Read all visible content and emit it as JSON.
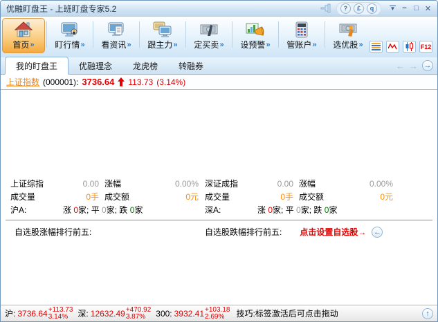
{
  "window": {
    "title": "优融盯盘王 - 上班盯盘专家5.2",
    "round_buttons": {
      "help": "?",
      "currency": "£",
      "quote": "q"
    },
    "controls": {
      "tray": "▼",
      "minimize": "−",
      "maximize": "□",
      "close": "✕"
    }
  },
  "toolbar": {
    "chevron": "»",
    "f12_label": "F12",
    "buttons": [
      {
        "label": "首页",
        "icon": "home-icon",
        "active": true
      },
      {
        "label": "盯行情",
        "icon": "watch-market-icon",
        "active": false
      },
      {
        "label": "看资讯",
        "icon": "news-icon",
        "active": false
      },
      {
        "label": "跟主力",
        "icon": "follow-mainforce-icon",
        "active": false
      },
      {
        "label": "定买卖",
        "icon": "set-trade-icon",
        "active": false
      },
      {
        "label": "设预警",
        "icon": "set-alert-icon",
        "active": false
      },
      {
        "label": "管账户",
        "icon": "manage-account-icon",
        "active": false
      },
      {
        "label": "选优股",
        "icon": "pick-stock-icon",
        "active": false
      }
    ]
  },
  "tabbar": {
    "tabs": [
      {
        "label": "我的盯盘王",
        "active": true
      },
      {
        "label": "优融理念",
        "active": false
      },
      {
        "label": "龙虎榜",
        "active": false
      },
      {
        "label": "转融券",
        "active": false
      }
    ],
    "nav_back": "←",
    "nav_forward": "→",
    "nav_go": "→"
  },
  "index_header": {
    "name": "上证指数",
    "code": "(000001):",
    "price": "3736.64",
    "change": "113.73",
    "change_pct": "(3.14%)"
  },
  "market_stats": {
    "left": {
      "index_label": "上证综指",
      "index_value": "0.00",
      "chg_label": "涨幅",
      "chg_value": "0.00%",
      "vol_label": "成交量",
      "vol_value": "0手",
      "amt_label": "成交额",
      "amt_value": "0元",
      "board_label": "沪A:",
      "up": {
        "label": "涨 ",
        "value": "0",
        "unit": "家; "
      },
      "flat": {
        "label": "平 ",
        "value": "0",
        "unit": "家; "
      },
      "down": {
        "label": "跌 ",
        "value": "0",
        "unit": "家"
      }
    },
    "right": {
      "index_label": "深证成指",
      "index_value": "0.00",
      "chg_label": "涨幅",
      "chg_value": "0.00%",
      "vol_label": "成交量",
      "vol_value": "0手",
      "amt_label": "成交额",
      "amt_value": "0元",
      "board_label": "深A:",
      "up": {
        "label": "涨 ",
        "value": "0",
        "unit": "家; "
      },
      "flat": {
        "label": "平 ",
        "value": "0",
        "unit": "家; "
      },
      "down": {
        "label": "跌 ",
        "value": "0",
        "unit": "家"
      }
    }
  },
  "watchlist": {
    "gainers_label": "自选股涨幅排行前五:",
    "losers_label": "自选股跌幅排行前五:",
    "setup_hint": "点击设置自选股→",
    "collapse_arrow": "←"
  },
  "statusbar": {
    "items": [
      {
        "label": "沪:",
        "value": "3736.64",
        "change": "+113.73",
        "pct": "3.14%"
      },
      {
        "label": "深:",
        "value": "12632.49",
        "change": "+470.92",
        "pct": "3.87%"
      },
      {
        "label": "300:",
        "value": "3932.41",
        "change": "+103.18",
        "pct": "2.69%"
      }
    ],
    "tip": "技巧:标签激活后可点击拖动",
    "top_arrow": "↑"
  },
  "colors": {
    "up_red": "#e00000",
    "down_green": "#007700",
    "value_orange": "#ff8c00",
    "neutral_gray": "#9a9a9a",
    "active_button_orange": "#f6a93e",
    "accent_blue": "#2e7bc4"
  }
}
